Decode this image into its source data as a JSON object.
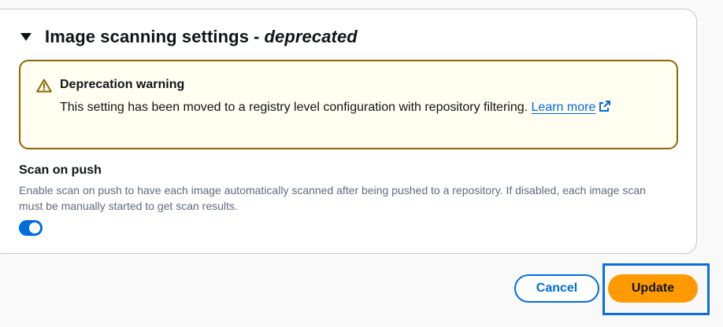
{
  "section": {
    "title": "Image scanning settings",
    "separator": "-",
    "title_suffix": "deprecated"
  },
  "alert": {
    "title": "Deprecation warning",
    "body": "This setting has been moved to a registry level configuration with repository filtering.",
    "link_text": "Learn more",
    "icon": "warning-icon",
    "link_icon": "external-link-icon"
  },
  "scan_on_push": {
    "label": "Scan on push",
    "description": "Enable scan on push to have each image automatically scanned after being pushed to a repository. If disabled, each image scan must be manually started to get scan results.",
    "enabled": true
  },
  "actions": {
    "cancel_label": "Cancel",
    "update_label": "Update"
  },
  "colors": {
    "accent": "#006ce0",
    "primary_button": "#ff9900",
    "warning_border": "#8d6605",
    "warning_bg": "#fffef0"
  }
}
